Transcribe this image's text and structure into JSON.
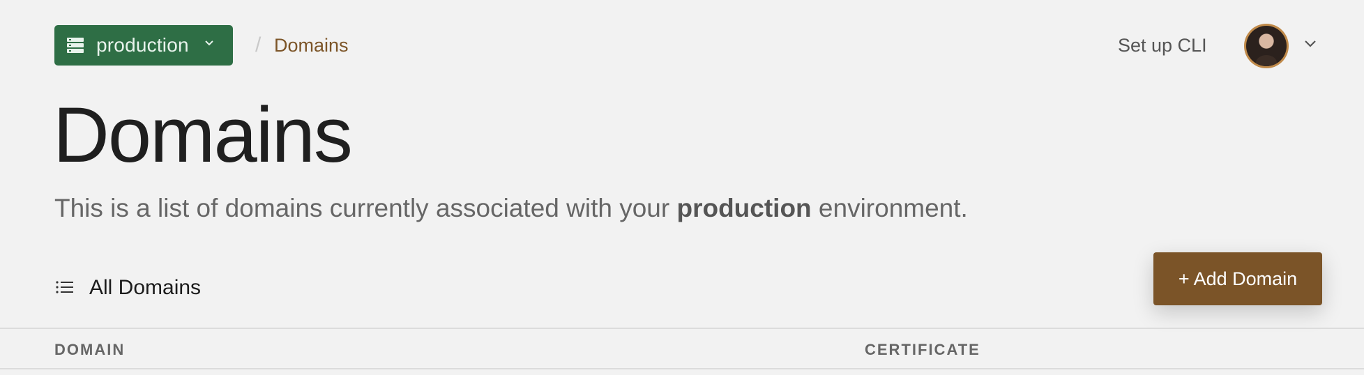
{
  "header": {
    "environment": "production",
    "breadcrumb_current": "Domains",
    "breadcrumb_separator": "/",
    "setup_cli_label": "Set up CLI",
    "avatar_alt": "User avatar"
  },
  "main": {
    "title": "Domains",
    "subtitle_pre": "This is a list of domains currently associated with your ",
    "subtitle_env": "production",
    "subtitle_post": " environment.",
    "list_label": "All Domains",
    "add_button": "+ Add Domain",
    "columns": [
      "DOMAIN",
      "CERTIFICATE"
    ]
  },
  "colors": {
    "env_green": "#2e6e45",
    "accent_brown": "#7b5428",
    "link_brown": "#7c5528",
    "background": "#f2f2f2"
  },
  "icons": {
    "env": "server-stack-icon",
    "env_dropdown": "chevron-down-icon",
    "user_dropdown": "chevron-down-icon",
    "list": "list-icon"
  }
}
